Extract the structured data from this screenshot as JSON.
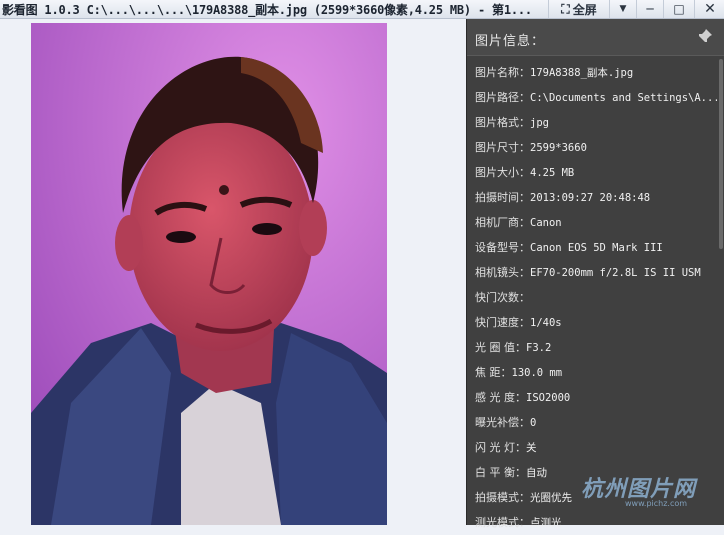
{
  "window": {
    "title": "影看图 1.0.3  C:\\...\\...\\...\\179A8388_副本.jpg (2599*3660像素,4.25 MB) - 第1...",
    "fullscreen_label": "全屏",
    "menu_glyph": "▼",
    "min_glyph": "─",
    "max_glyph": "□",
    "close_glyph": "✕"
  },
  "photo": {
    "colors": {
      "background": "#c56ccf",
      "skin": "#c8465a",
      "jacket": "#2c3a6a",
      "hair": "#3a1a18"
    }
  },
  "panel": {
    "title": "图片信息：",
    "rows": [
      {
        "label": "图片名称：",
        "value": "179A8388_副本.jpg"
      },
      {
        "label": "图片路径：",
        "value": "C:\\Documents and Settings\\A..."
      },
      {
        "label": "图片格式：",
        "value": "jpg"
      },
      {
        "label": "图片尺寸：",
        "value": "2599*3660"
      },
      {
        "label": "图片大小：",
        "value": "4.25 MB"
      },
      {
        "label": "拍摄时间：",
        "value": "2013:09:27 20:48:48"
      },
      {
        "label": "相机厂商：",
        "value": "Canon"
      },
      {
        "label": "设备型号：",
        "value": "Canon EOS 5D Mark III"
      },
      {
        "label": "相机镜头：",
        "value": "EF70-200mm f/2.8L IS II USM"
      },
      {
        "label": "快门次数：",
        "value": ""
      },
      {
        "label": "快门速度：",
        "value": "1/40s"
      },
      {
        "label": "光 圈 值：",
        "value": "F3.2"
      },
      {
        "label": "焦    距：",
        "value": "130.0 mm"
      },
      {
        "label": "感 光 度：",
        "value": "ISO2000"
      },
      {
        "label": "曝光补偿：",
        "value": "0"
      },
      {
        "label": "闪 光 灯：",
        "value": "关"
      },
      {
        "label": "白 平 衡：",
        "value": "自动"
      },
      {
        "label": "拍摄模式：",
        "value": "光圈优先"
      },
      {
        "label": "测光模式：",
        "value": "点测光"
      }
    ]
  },
  "watermark": {
    "text": "杭州图片网",
    "url": "www.pichz.com"
  }
}
